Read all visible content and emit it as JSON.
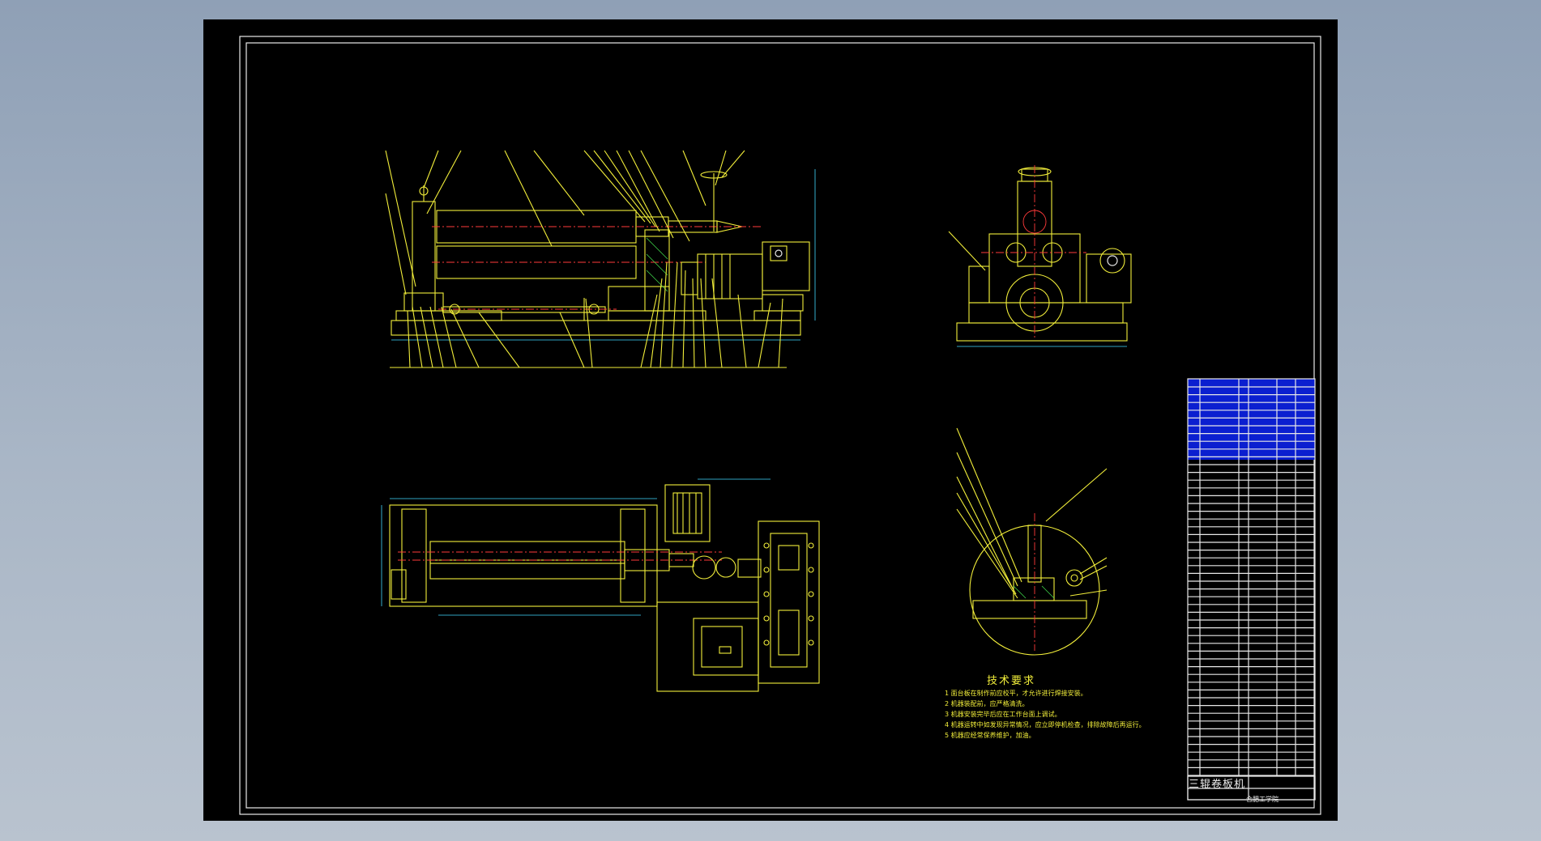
{
  "drawing": {
    "title": "三辊卷板机",
    "school": "合肥工学院",
    "technical_requirements": {
      "heading": "技术要求",
      "items": [
        "1 面台板在制作前应校平，才允许进行焊接安装。",
        "2 机器装配前，应严格清洗。",
        "3 机器安装完毕后应在工作台面上调试。",
        "4 机器运转中如发现异常情况，应立即停机检查，排除故障后再运行。",
        "5 机器应经常保养维护，加油。"
      ]
    }
  },
  "colors": {
    "background": "#000000",
    "primary_lines": "#f2ee3a",
    "frame": "#e8e8e8",
    "centerlines": "#ff3a3a",
    "dimensions": "#40d8ff",
    "hatch": "#3fd84a",
    "table_header": "#0b1fd0"
  }
}
